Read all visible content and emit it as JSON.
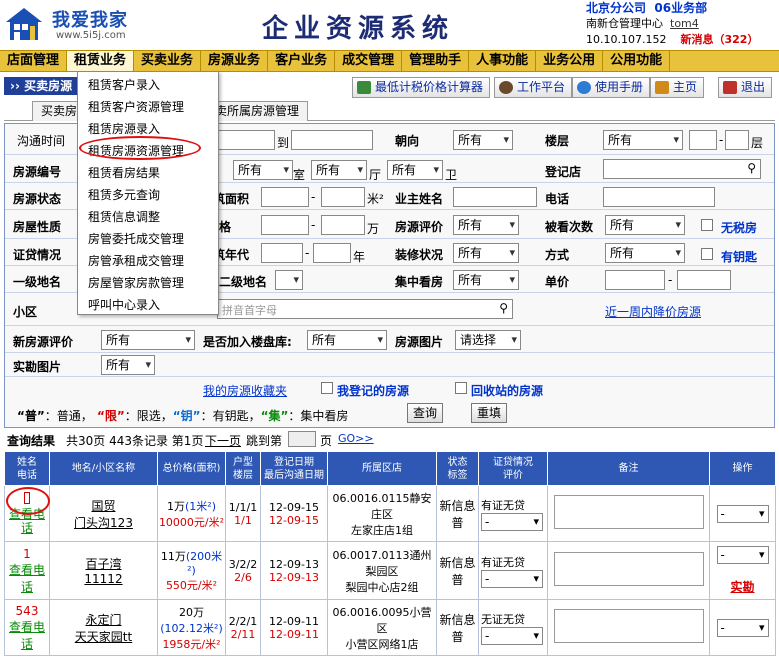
{
  "header": {
    "logo_text": "我爱我家",
    "logo_url": "www.5i5j.com",
    "system_title": "企业资源系统",
    "company": "北京分公司",
    "department": "06业务部",
    "center": "南新仓管理中心",
    "username": "tom4",
    "ip": "10.10.107.152",
    "new_msg_label": "新消息（322）"
  },
  "main_nav": [
    "店面管理",
    "租赁业务",
    "买卖业务",
    "房源业务",
    "客户业务",
    "成交管理",
    "管理助手",
    "人事功能",
    "业务公用",
    "公用功能"
  ],
  "breadcrumb": "›› 买卖房源",
  "toolbar": {
    "calc": "最低计税价格计算器",
    "workbench": "工作平台",
    "manual": "使用手册",
    "home": "主页",
    "logout": "退出"
  },
  "tabs": [
    "买卖房",
    "卖所属房源管理"
  ],
  "dropdown_items": [
    "租赁客户录入",
    "租赁客户资源管理",
    "租赁房源录入",
    "租赁房源资源管理",
    "租赁看房结果",
    "租赁多元查询",
    "租赁信息调整",
    "房管委托成交管理",
    "房管承租成交管理",
    "房屋管家房款管理",
    "呼叫中心录入"
  ],
  "form": {
    "row1": {
      "l1": "沟通时间",
      "to": "到",
      "l2": "朝向",
      "v2": "所有",
      "l3": "楼层",
      "v3": "所有",
      "unit3": "层"
    },
    "row2": {
      "l1": "房源编号",
      "v1": "所有",
      "v1b": "所有",
      "shi": "室",
      "ting": "厅",
      "v1c": "所有",
      "wei": "卫",
      "l3": "登记店"
    },
    "row3": {
      "l1": "房源状态",
      "l1b": "筑面积",
      "unit": "米²",
      "l2": "业主姓名",
      "l3": "电话"
    },
    "row4": {
      "l1": "房屋性质",
      "l1b": "格",
      "unit": "万",
      "l2": "房源评价",
      "v2": "所有",
      "l3": "被看次数",
      "v3": "所有",
      "chk": "无税房"
    },
    "row5": {
      "l1": "证贷情况",
      "l1b": "筑年代",
      "unit": "年",
      "l2": "装修状况",
      "v2": "所有",
      "l3": "方式",
      "v3": "所有",
      "chk": "有钥匙"
    },
    "row6": {
      "l1": "一级地名",
      "l1b": "二级地名",
      "l2": "集中看房",
      "v2": "所有",
      "l3": "单价"
    },
    "row7": {
      "l1": "小区",
      "placeholder": "拼音首字母",
      "link": "近一周内降价房源"
    },
    "row8": {
      "l1": "新房源评价",
      "v1": "所有",
      "l2": "是否加入楼盘库:",
      "v2": "所有",
      "l3": "房源图片",
      "v3": "请选择"
    },
    "row9": {
      "l1": "实勘图片",
      "v1": "所有"
    },
    "row10": {
      "fav": "我的房源收藏夹",
      "chk1": "我登记的房源",
      "chk2": "回收站的房源"
    },
    "legend": {
      "pu_q": "“普”",
      "pu": "：普通，",
      "xian_q": "“限”",
      "xian": "：限选，",
      "yao_q": "“钥”",
      "yao": "：有钥匙，",
      "ji_q": "“集”",
      "ji": "：集中看房"
    },
    "query_btn": "查询",
    "reset_btn": "重填"
  },
  "results_bar": {
    "title": "查询结果",
    "summary": "共30页 443条记录 第1页",
    "next": "下一页",
    "jump": "跳到第",
    "page_unit": "页",
    "go": "GO>>"
  },
  "table_headers": [
    "姓名\n电话",
    "地名/小区名称",
    "总价格(面积)",
    "户型\n楼层",
    "登记日期\n最后沟通日期",
    "所属区店",
    "状态\n标签",
    "证贷情况\n评价",
    "备注",
    "操作"
  ],
  "rows": [
    {
      "name": "",
      "phone_link": "查看电话",
      "place": "国贸",
      "community": "门头沟123",
      "price": "1万",
      "area": "(1米²)",
      "unit_price": "10000元/米²",
      "layout": "1/1/1",
      "floor": "1/1",
      "reg_date": "12-09-15",
      "last_date": "12-09-15",
      "store_code": "06.0016.0115静安庄区",
      "store_name": "左家庄店1组",
      "status": "新信息",
      "tag": "普",
      "loan": "有证无贷",
      "eval": "-",
      "op": "-",
      "op_link": ""
    },
    {
      "name": "1",
      "phone_link": "查看电话",
      "place": "百子湾",
      "community": "11112",
      "price": "11万",
      "area": "(200米²)",
      "unit_price": "550元/米²",
      "layout": "3/2/2",
      "floor": "2/6",
      "reg_date": "12-09-13",
      "last_date": "12-09-13",
      "store_code": "06.0017.0113通州梨园区",
      "store_name": "梨园中心店2组",
      "status": "新信息",
      "tag": "普",
      "loan": "有证无贷",
      "eval": "-",
      "op": "-",
      "op_link": "实勘"
    },
    {
      "name": "543",
      "phone_link": "查看电话",
      "place": "永定门",
      "community": "天天家园tt",
      "price": "20万",
      "area": "(102.12米²)",
      "unit_price": "1958元/米²",
      "layout": "2/2/1",
      "floor": "2/11",
      "reg_date": "12-09-11",
      "last_date": "12-09-11",
      "store_code": "06.0016.0095小营区",
      "store_name": "小营区网络1店",
      "status": "新信息",
      "tag": "普",
      "loan": "无证无贷",
      "eval": "-",
      "op": "-",
      "op_link": ""
    }
  ],
  "colors": {
    "nav_bg": "#e9c23b",
    "header_blue": "#2e58b3",
    "accent_red": "#d40000",
    "link_blue": "#0033cc"
  }
}
